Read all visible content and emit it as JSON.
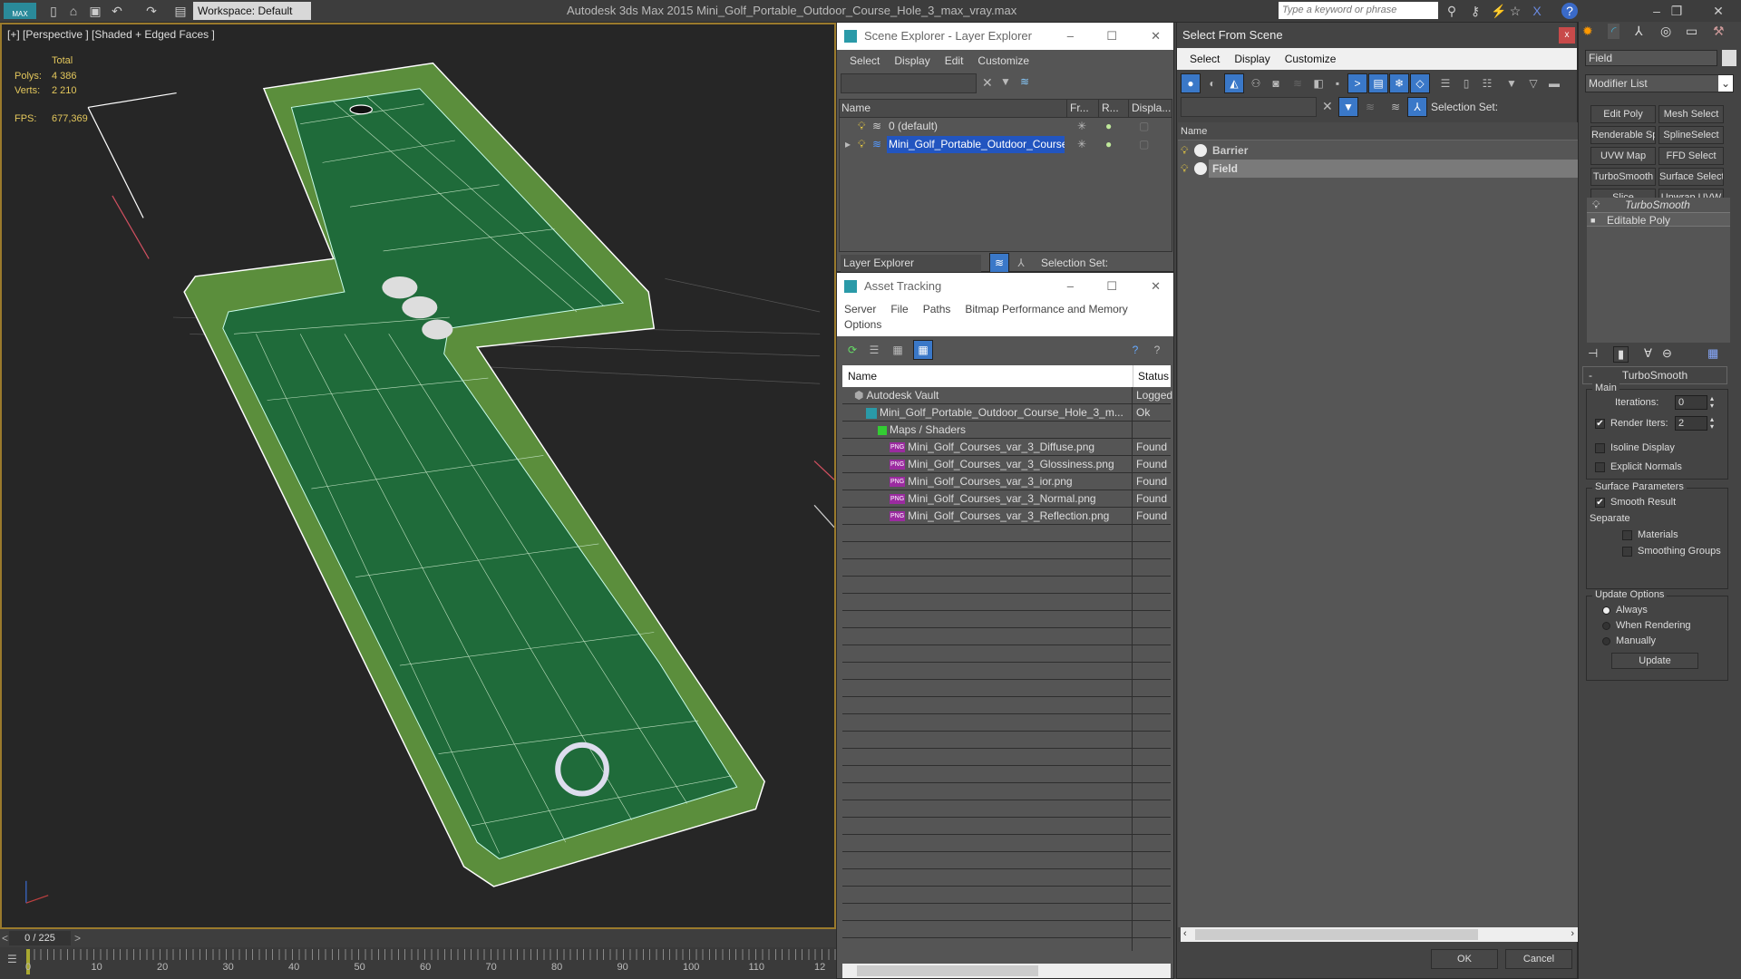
{
  "titlebar": {
    "app_title": "Autodesk 3ds Max  2015     Mini_Golf_Portable_Outdoor_Course_Hole_3_max_vray.max",
    "app_logo": "MAX",
    "workspace": "Workspace: Default",
    "search_placeholder": "Type a keyword or phrase",
    "icons": [
      "new-icon",
      "open-icon",
      "save-icon",
      "undo-icon",
      "redo-icon",
      "project-icon"
    ]
  },
  "viewport": {
    "label": "[+] [Perspective ] [Shaded + Edged Faces ]",
    "stats": {
      "total": "Total",
      "polys_label": "Polys:",
      "polys": "4 386",
      "verts_label": "Verts:",
      "verts": "2 210",
      "fps_label": "FPS:",
      "fps": "677,369"
    }
  },
  "timeline": {
    "frame": "0 / 225",
    "ticks": [
      "0",
      "10",
      "20",
      "30",
      "40",
      "50",
      "60",
      "70",
      "80",
      "90",
      "100",
      "110",
      "12"
    ]
  },
  "scene_explorer": {
    "title": "Scene Explorer - Layer Explorer",
    "menu": [
      "Select",
      "Display",
      "Edit",
      "Customize"
    ],
    "columns": [
      "Name",
      "Fr...",
      "R...",
      "Displa..."
    ],
    "rows": [
      {
        "name": "0 (default)",
        "selected": false
      },
      {
        "name": "Mini_Golf_Portable_Outdoor_Course_...",
        "selected": true
      }
    ],
    "mode": "Layer Explorer",
    "selection_set": "Selection Set:"
  },
  "asset_tracking": {
    "title": "Asset Tracking",
    "menu": [
      "Server",
      "File",
      "Paths",
      "Bitmap Performance and Memory"
    ],
    "menu2": "Options",
    "columns": [
      "Name",
      "Status"
    ],
    "rows": [
      {
        "name": "Autodesk Vault",
        "status": "Logged",
        "indent": 1,
        "icon": "vault"
      },
      {
        "name": "Mini_Golf_Portable_Outdoor_Course_Hole_3_m...",
        "status": "Ok",
        "indent": 2,
        "icon": "max"
      },
      {
        "name": "Maps / Shaders",
        "status": "",
        "indent": 3,
        "icon": "maps"
      },
      {
        "name": "Mini_Golf_Courses_var_3_Diffuse.png",
        "status": "Found",
        "indent": 4,
        "icon": "png"
      },
      {
        "name": "Mini_Golf_Courses_var_3_Glossiness.png",
        "status": "Found",
        "indent": 4,
        "icon": "png"
      },
      {
        "name": "Mini_Golf_Courses_var_3_ior.png",
        "status": "Found",
        "indent": 4,
        "icon": "png"
      },
      {
        "name": "Mini_Golf_Courses_var_3_Normal.png",
        "status": "Found",
        "indent": 4,
        "icon": "png"
      },
      {
        "name": "Mini_Golf_Courses_var_3_Reflection.png",
        "status": "Found",
        "indent": 4,
        "icon": "png"
      }
    ]
  },
  "select_from_scene": {
    "title": "Select From Scene",
    "close": "x",
    "menu": [
      "Select",
      "Display",
      "Customize"
    ],
    "selection_set": "Selection Set:",
    "column": "Name",
    "rows": [
      {
        "name": "Barrier",
        "selected": false
      },
      {
        "name": "Field",
        "selected": true
      }
    ],
    "ok": "OK",
    "cancel": "Cancel"
  },
  "command_panel": {
    "object_name": "Field",
    "modifier_list": "Modifier List",
    "modifier_buttons": [
      "Edit Poly",
      "Mesh Select",
      "Renderable Spline",
      "SplineSelect",
      "UVW Map",
      "FFD Select",
      "TurboSmooth",
      "Surface Select",
      "Slice",
      "Unwrap UVW"
    ],
    "stack": [
      "TurboSmooth",
      "Editable Poly"
    ],
    "rollout": {
      "title": "TurboSmooth",
      "collapse": "-",
      "main": "Main",
      "iterations_label": "Iterations:",
      "iterations": "0",
      "render_iters_label": "Render Iters:",
      "render_iters": "2",
      "render_iters_checked": true,
      "isoline": "Isoline Display",
      "isoline_checked": false,
      "explicit": "Explicit Normals",
      "explicit_checked": false,
      "surface": "Surface Parameters",
      "smooth_result": "Smooth Result",
      "smooth_checked": true,
      "separate": "Separate",
      "materials": "Materials",
      "smoothing_groups": "Smoothing Groups",
      "update_options": "Update Options",
      "always": "Always",
      "when_rendering": "When Rendering",
      "manually": "Manually",
      "selected_update": "Always",
      "update": "Update"
    }
  },
  "colors": {
    "accent": "#3a78c8",
    "selection": "#2255c0",
    "viewport_border": "#9a7a2c",
    "stats": "#e3c75c",
    "field_green": "#1f6b3a"
  }
}
